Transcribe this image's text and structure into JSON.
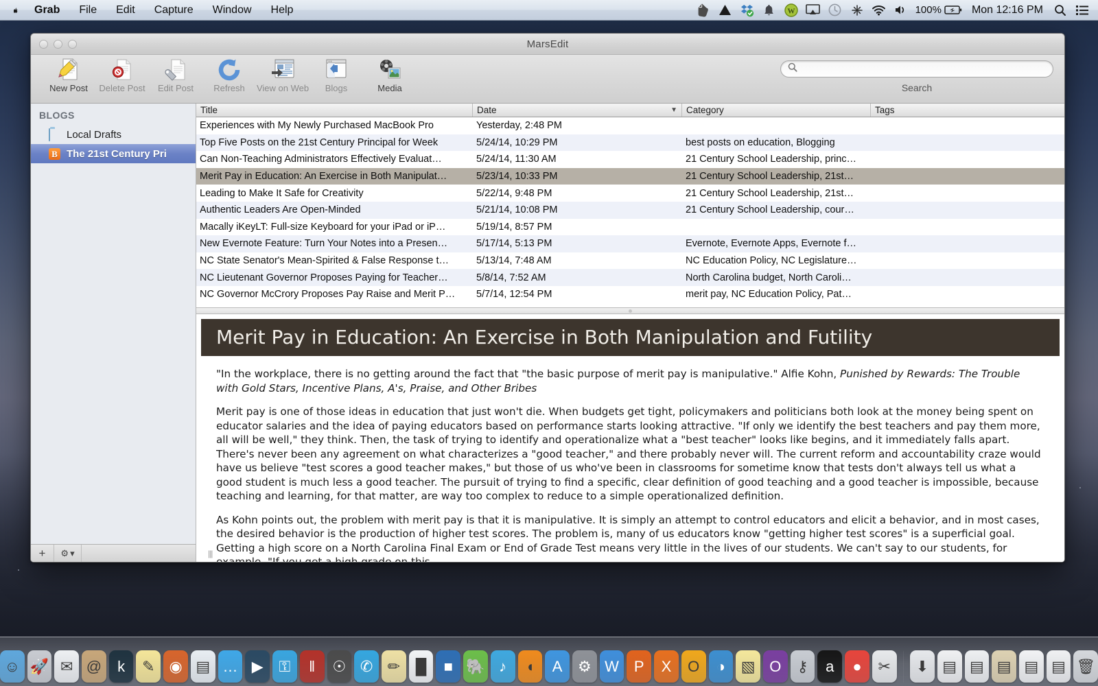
{
  "menubar": {
    "apple_icon": "apple-logo",
    "items": [
      {
        "label": "Grab",
        "bold": true
      },
      {
        "label": "File",
        "bold": false
      },
      {
        "label": "Edit",
        "bold": false
      },
      {
        "label": "Capture",
        "bold": false
      },
      {
        "label": "Window",
        "bold": false
      },
      {
        "label": "Help",
        "bold": false
      }
    ],
    "status_icons": [
      "evernote-icon",
      "google-drive-icon",
      "dropbox-icon",
      "notification-bell-icon",
      "wordpress-icon",
      "airplay-icon",
      "time-machine-icon",
      "bluetooth-sync-icon",
      "wifi-icon",
      "volume-icon"
    ],
    "battery_percent": "100%",
    "clock": "Mon 12:16 PM",
    "spotlight_icon": "search-icon",
    "notification_center_icon": "list-icon"
  },
  "window": {
    "title": "MarsEdit",
    "traffic_lights": [
      "close-button",
      "minimize-button",
      "zoom-button"
    ]
  },
  "toolbar": {
    "buttons": [
      {
        "label": "New Post",
        "icon": "new-post-icon",
        "dim": false
      },
      {
        "label": "Delete Post",
        "icon": "delete-post-icon",
        "dim": true
      },
      {
        "label": "Edit Post",
        "icon": "edit-post-icon",
        "dim": true
      },
      {
        "label": "Refresh",
        "icon": "refresh-icon",
        "dim": false
      },
      {
        "label": "View on Web",
        "icon": "view-on-web-icon",
        "dim": false
      },
      {
        "label": "Blogs",
        "icon": "blogs-icon",
        "dim": false
      },
      {
        "label": "Media",
        "icon": "media-icon",
        "dim": false
      }
    ],
    "search": {
      "value": "",
      "placeholder": "",
      "label": "Search",
      "icon": "search-icon"
    }
  },
  "sidebar": {
    "header": "BLOGS",
    "items": [
      {
        "label": "Local Drafts",
        "icon": "folder-icon",
        "selected": false
      },
      {
        "label": "The 21st Century Pri",
        "icon": "blogger-icon",
        "selected": true
      }
    ],
    "footer": {
      "add_label": "+",
      "gear_label": "⚙",
      "gear_chevron": "▾"
    }
  },
  "post_table": {
    "columns": [
      "Title",
      "Date",
      "Category",
      "Tags"
    ],
    "sort_column": "Date",
    "sort_indicator": "▼",
    "rows": [
      {
        "title": "Experiences with My Newly Purchased MacBook Pro",
        "date": "Yesterday, 2:48 PM",
        "category": "",
        "tags": ""
      },
      {
        "title": "Top Five Posts on the 21st Century Principal for Week",
        "date": "5/24/14, 10:29 PM",
        "category": "best posts on education, Blogging",
        "tags": ""
      },
      {
        "title": "Can Non-Teaching Administrators Effectively Evaluat…",
        "date": "5/24/14, 11:30 AM",
        "category": "21 Century School Leadership, princ…",
        "tags": ""
      },
      {
        "title": "Merit Pay in Education: An Exercise in Both Manipulat…",
        "date": "5/23/14, 10:33 PM",
        "category": "21 Century School Leadership, 21st…",
        "tags": ""
      },
      {
        "title": "Leading to Make It Safe for Creativity",
        "date": "5/22/14, 9:48 PM",
        "category": "21 Century School Leadership, 21st…",
        "tags": ""
      },
      {
        "title": "Authentic Leaders Are Open-Minded",
        "date": "5/21/14, 10:08 PM",
        "category": "21 Century School Leadership, cour…",
        "tags": ""
      },
      {
        "title": "Macally iKeyLT: Full-size Keyboard for your iPad or iP…",
        "date": "5/19/14, 8:57 PM",
        "category": "",
        "tags": ""
      },
      {
        "title": "New Evernote Feature: Turn Your Notes into a Presen…",
        "date": "5/17/14, 5:13 PM",
        "category": "Evernote, Evernote Apps, Evernote f…",
        "tags": ""
      },
      {
        "title": "NC State Senator's Mean-Spirited & False Response t…",
        "date": "5/13/14, 7:48 AM",
        "category": "NC Education Policy, NC Legislature…",
        "tags": ""
      },
      {
        "title": "NC Lieutenant Governor Proposes Paying for Teacher…",
        "date": "5/8/14, 7:52 AM",
        "category": "North Carolina budget, North Caroli…",
        "tags": ""
      },
      {
        "title": "NC Governor McCrory Proposes Pay Raise and Merit P…",
        "date": "5/7/14, 12:54 PM",
        "category": "merit pay, NC Education Policy, Pat…",
        "tags": ""
      }
    ],
    "selected_row_index": 3
  },
  "preview": {
    "title": "Merit Pay in Education: An Exercise in Both Manipulation and Futility",
    "title_bar_color": "#3d352d",
    "paragraphs": {
      "p1_plain": "\"In the workplace, there is no getting around the fact that \"the basic purpose of merit pay is manipulative.\" Alfie Kohn, ",
      "p1_italic": "Punished by Rewards: The Trouble with Gold Stars, Incentive Plans, A's, Praise, and Other Bribes",
      "p2": "Merit pay is one of those ideas in education that just won't die. When budgets get tight, policymakers and politicians both look at the money being spent on educator salaries and the idea of paying educators based on performance starts looking attractive. \"If only we identify the best teachers and pay them more, all will be well,\" they think. Then, the task of trying to identify and operationalize what a \"best teacher\" looks like begins, and it immediately falls apart. There's never been any agreement on what characterizes a \"good teacher,\" and there probably never will. The current reform and accountability craze would have us believe \"test scores a good teacher makes,\" but those of us who've been in classrooms for sometime know that tests don't always tell us what a good student is much less a good teacher. The pursuit of trying to find a specific, clear definition of good teaching and a good teacher is impossible, because teaching and learning, for that matter, are way too complex to reduce to a simple operationalized definition.",
      "p3": "As Kohn points out, the problem with merit pay is that it is manipulative. It is simply an attempt to control educators and elicit a behavior, and in most cases, the desired behavior is the production of higher test scores. The problem is, many of us educators know \"getting higher test scores\" is a superficial goal. Getting a high score on a North Carolina Final Exam or End of Grade Test means very little in the lives of our students. We can't say to our students, for example, \"If you get a high grade on this"
    }
  },
  "dock": {
    "items": [
      {
        "name": "finder",
        "glyph": "☺",
        "bg": "#5fa8dd",
        "running": true
      },
      {
        "name": "launchpad",
        "glyph": "🚀",
        "bg": "#c9ccd2",
        "running": false
      },
      {
        "name": "mail-stamp",
        "glyph": "✉",
        "bg": "#eef0f3",
        "running": false
      },
      {
        "name": "contacts",
        "glyph": "@",
        "bg": "#c8a77a",
        "running": false
      },
      {
        "name": "kindle",
        "glyph": "k",
        "bg": "#1f3340",
        "running": false
      },
      {
        "name": "notes",
        "glyph": "✎",
        "bg": "#f5e69a",
        "running": false
      },
      {
        "name": "safari",
        "glyph": "◉",
        "bg": "#d8652c",
        "running": true
      },
      {
        "name": "news-reader",
        "glyph": "▤",
        "bg": "#e9eef3",
        "running": false
      },
      {
        "name": "messages",
        "glyph": "…",
        "bg": "#3fa8e8",
        "running": true
      },
      {
        "name": "facetime",
        "glyph": "▶",
        "bg": "#2b4a63",
        "running": false
      },
      {
        "name": "1password",
        "glyph": "⚿",
        "bg": "#39a6e0",
        "running": true
      },
      {
        "name": "scrivener",
        "glyph": "‖",
        "bg": "#b4322a",
        "running": false
      },
      {
        "name": "photo-booth",
        "glyph": "☉",
        "bg": "#4b4b4b",
        "running": false
      },
      {
        "name": "twitter",
        "glyph": "✆",
        "bg": "#35a7e0",
        "running": true
      },
      {
        "name": "marsedit",
        "glyph": "✏",
        "bg": "#efe1a5",
        "running": true
      },
      {
        "name": "numbers",
        "glyph": "█",
        "bg": "#f2f4f6",
        "running": false
      },
      {
        "name": "keynote",
        "glyph": "■",
        "bg": "#2e6fb5",
        "running": false
      },
      {
        "name": "evernote",
        "glyph": "🐘",
        "bg": "#6cbf4a",
        "running": true
      },
      {
        "name": "itunes",
        "glyph": "♪",
        "bg": "#3fa9e0",
        "running": false
      },
      {
        "name": "ibooks",
        "glyph": "◖",
        "bg": "#f08b1d",
        "running": false
      },
      {
        "name": "app-store",
        "glyph": "A",
        "bg": "#3f96e0",
        "running": false
      },
      {
        "name": "system-preferences",
        "glyph": "⚙",
        "bg": "#8f9298",
        "running": false
      },
      {
        "name": "microsoft-word",
        "glyph": "W",
        "bg": "#3f8fdc",
        "running": false
      },
      {
        "name": "microsoft-powerpoint",
        "glyph": "P",
        "bg": "#e2631d",
        "running": false
      },
      {
        "name": "microsoft-excel",
        "glyph": "X",
        "bg": "#e8701f",
        "running": false
      },
      {
        "name": "microsoft-outlook",
        "glyph": "O",
        "bg": "#f0a81c",
        "running": false
      },
      {
        "name": "firefox",
        "glyph": "◑",
        "bg": "#3d8fd0",
        "running": false
      },
      {
        "name": "stickies",
        "glyph": "▧",
        "bg": "#f5e89c",
        "running": false
      },
      {
        "name": "onenote",
        "glyph": "O",
        "bg": "#7a3fa0",
        "running": false
      },
      {
        "name": "keychain-access",
        "glyph": "⚷",
        "bg": "#c9cdd3",
        "running": false
      },
      {
        "name": "amazon",
        "glyph": "a",
        "bg": "#161616",
        "running": false
      },
      {
        "name": "google-chrome",
        "glyph": "●",
        "bg": "#e8453c",
        "running": true
      },
      {
        "name": "grab",
        "glyph": "✂",
        "bg": "#e8eaec",
        "running": true
      }
    ],
    "stack_items": [
      {
        "name": "downloads-stack",
        "glyph": "⬇",
        "bg": "#e7e9ec"
      },
      {
        "name": "document-window-1",
        "glyph": "▤",
        "bg": "#f0f1f3"
      },
      {
        "name": "document-window-2",
        "glyph": "▤",
        "bg": "#eef0f2"
      },
      {
        "name": "document-window-3",
        "glyph": "▤",
        "bg": "#ded2b3"
      },
      {
        "name": "document-window-4",
        "glyph": "▤",
        "bg": "#f2f3f5"
      },
      {
        "name": "document-window-5",
        "glyph": "▤",
        "bg": "#f0f1f3"
      },
      {
        "name": "trash",
        "glyph": "🗑",
        "bg": "#d5d8dc"
      }
    ]
  }
}
